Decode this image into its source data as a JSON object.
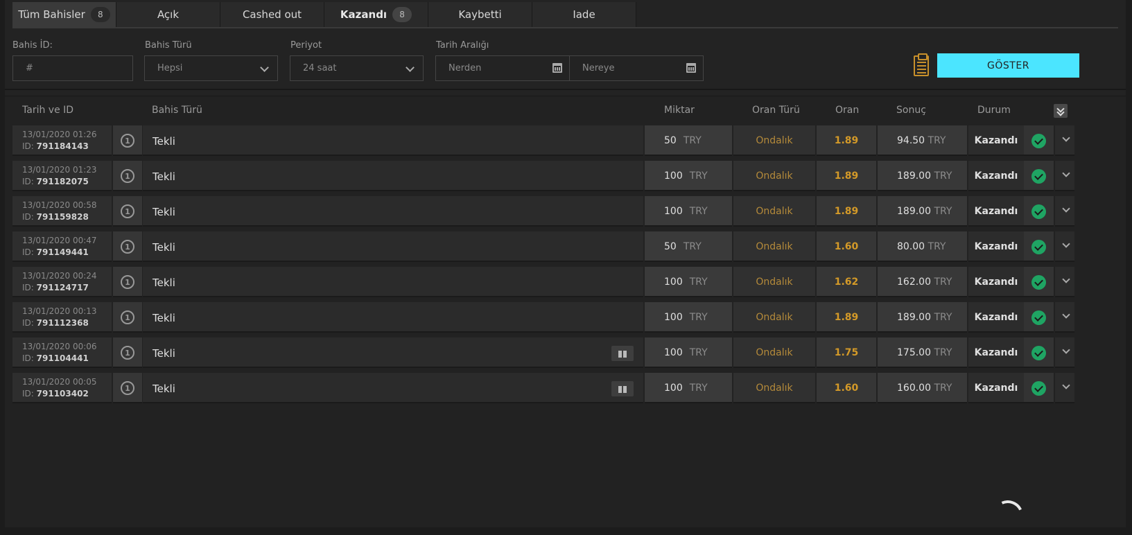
{
  "tabs": [
    {
      "label": "Tüm Bahisler",
      "count": "8"
    },
    {
      "label": "Açık"
    },
    {
      "label": "Cashed out"
    },
    {
      "label": "Kazandı",
      "count": "8"
    },
    {
      "label": "Kaybetti"
    },
    {
      "label": "Iade"
    }
  ],
  "filters": {
    "bet_id_label": "Bahis İD:",
    "bet_id_placeholder": "#",
    "bet_type_label": "Bahis Türü",
    "bet_type_value": "Hepsi",
    "period_label": "Periyot",
    "period_value": "24 saat",
    "date_range_label": "Tarih Aralığı",
    "from_placeholder": "Nerden",
    "to_placeholder": "Nereye",
    "show_button": "GÖSTER"
  },
  "table": {
    "headers": {
      "date_id": "Tarih ve ID",
      "bet_type": "Bahis Türü",
      "amount": "Miktar",
      "odds_type": "Oran Türü",
      "odds": "Oran",
      "result": "Sonuç",
      "status": "Durum"
    },
    "id_prefix": "ID:",
    "rows": [
      {
        "date": "13/01/2020 01:26",
        "id": "791184143",
        "num": "1",
        "type": "Tekli",
        "amount": "50",
        "currency": "TRY",
        "odds_type": "Ondalık",
        "odds": "1.89",
        "result": "94.50",
        "status": "Kazandı",
        "gift": false
      },
      {
        "date": "13/01/2020 01:23",
        "id": "791182075",
        "num": "1",
        "type": "Tekli",
        "amount": "100",
        "currency": "TRY",
        "odds_type": "Ondalık",
        "odds": "1.89",
        "result": "189.00",
        "status": "Kazandı",
        "gift": false
      },
      {
        "date": "13/01/2020 00:58",
        "id": "791159828",
        "num": "1",
        "type": "Tekli",
        "amount": "100",
        "currency": "TRY",
        "odds_type": "Ondalık",
        "odds": "1.89",
        "result": "189.00",
        "status": "Kazandı",
        "gift": false
      },
      {
        "date": "13/01/2020 00:47",
        "id": "791149441",
        "num": "1",
        "type": "Tekli",
        "amount": "50",
        "currency": "TRY",
        "odds_type": "Ondalık",
        "odds": "1.60",
        "result": "80.00",
        "status": "Kazandı",
        "gift": false
      },
      {
        "date": "13/01/2020 00:24",
        "id": "791124717",
        "num": "1",
        "type": "Tekli",
        "amount": "100",
        "currency": "TRY",
        "odds_type": "Ondalık",
        "odds": "1.62",
        "result": "162.00",
        "status": "Kazandı",
        "gift": false
      },
      {
        "date": "13/01/2020 00:13",
        "id": "791112368",
        "num": "1",
        "type": "Tekli",
        "amount": "100",
        "currency": "TRY",
        "odds_type": "Ondalık",
        "odds": "1.89",
        "result": "189.00",
        "status": "Kazandı",
        "gift": false
      },
      {
        "date": "13/01/2020 00:06",
        "id": "791104441",
        "num": "1",
        "type": "Tekli",
        "amount": "100",
        "currency": "TRY",
        "odds_type": "Ondalık",
        "odds": "1.75",
        "result": "175.00",
        "status": "Kazandı",
        "gift": true
      },
      {
        "date": "13/01/2020 00:05",
        "id": "791103402",
        "num": "1",
        "type": "Tekli",
        "amount": "100",
        "currency": "TRY",
        "odds_type": "Ondalık",
        "odds": "1.60",
        "result": "160.00",
        "status": "Kazandı",
        "gift": true
      }
    ]
  },
  "colors": {
    "accent": "#4be5ff",
    "odds": "#d49a28",
    "odds_type": "#b48a3a",
    "win": "#1fa463"
  },
  "icons": {
    "calendar": "calendar-icon",
    "clipboard": "clipboard-icon",
    "check": "check-circle-icon",
    "gift": "gift-icon",
    "expand": "chevron-down-icon"
  }
}
